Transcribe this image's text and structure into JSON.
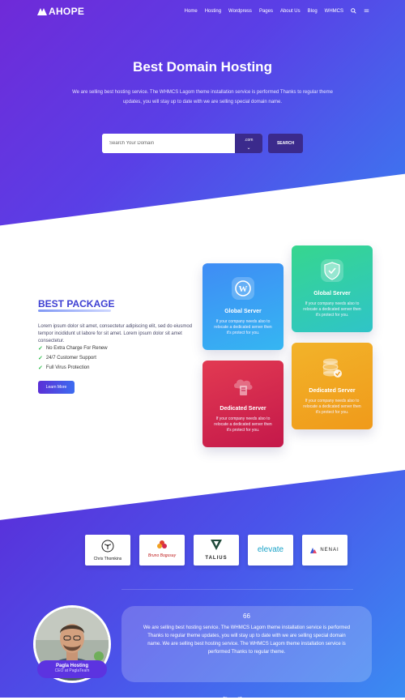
{
  "nav": {
    "logo": "AHOPE",
    "items": [
      "Home",
      "Hosting",
      "Wordpress",
      "Pages",
      "About Us",
      "Blog",
      "WHMCS"
    ]
  },
  "hero": {
    "title": "Best Domain Hosting",
    "subtitle": "We are selling best hosting service. The WHMCS Lagom theme installation service is performed Thanks to regular theme updates, you will stay up to date with we are selling special domain name.",
    "search_placeholder": "Search Your Domain",
    "tld": ".com",
    "search_button": "SEARCH"
  },
  "package": {
    "title": "BEST PACKAGE",
    "description": "Lorem ipsum dolor sit amet, consectetur adipiscing elit, sed do eiusmod tempor incididunt ut labore for sit amet. Lorem ipsum dolor sit amet consectetur.",
    "features": [
      "No Extra Charge For Renew",
      "24/7 Customer Support",
      "Full Virus Protection"
    ],
    "button": "Learn More",
    "cards": [
      {
        "title": "Global Server",
        "text": "If your company needs also to relocate a dedicated server then it's protect for you.",
        "icon": "wordpress-icon"
      },
      {
        "title": "Global Server",
        "text": "If your company needs also to relocate a dedicated server then it's protect for you.",
        "icon": "shield-icon"
      },
      {
        "title": "Dedicated Server",
        "text": "If your company needs also to relocate a dedicated server then it's protect for you.",
        "icon": "cloud-server-icon"
      },
      {
        "title": "Dedicated Server",
        "text": "If your company needs also to relocate a dedicated server then it's protect for you.",
        "icon": "database-check-icon"
      }
    ]
  },
  "brands": [
    "Chris Thomkins",
    "Bruno Bogusay",
    "TALIUS",
    "elevate",
    "NENAI"
  ],
  "testimonial": {
    "number": "66",
    "text": "We are selling best hosting service. The WHMCS Lagom theme installation service is performed Thanks to regular theme updates, you will stay up to date with we are selling special domain name. We are selling best hosting service. The WHMCS Lagom theme installation service is performed Thanks to regular theme.",
    "name": "Pagla Hosting",
    "role": "CEO at PaglaTeam"
  },
  "arrows": "← →"
}
